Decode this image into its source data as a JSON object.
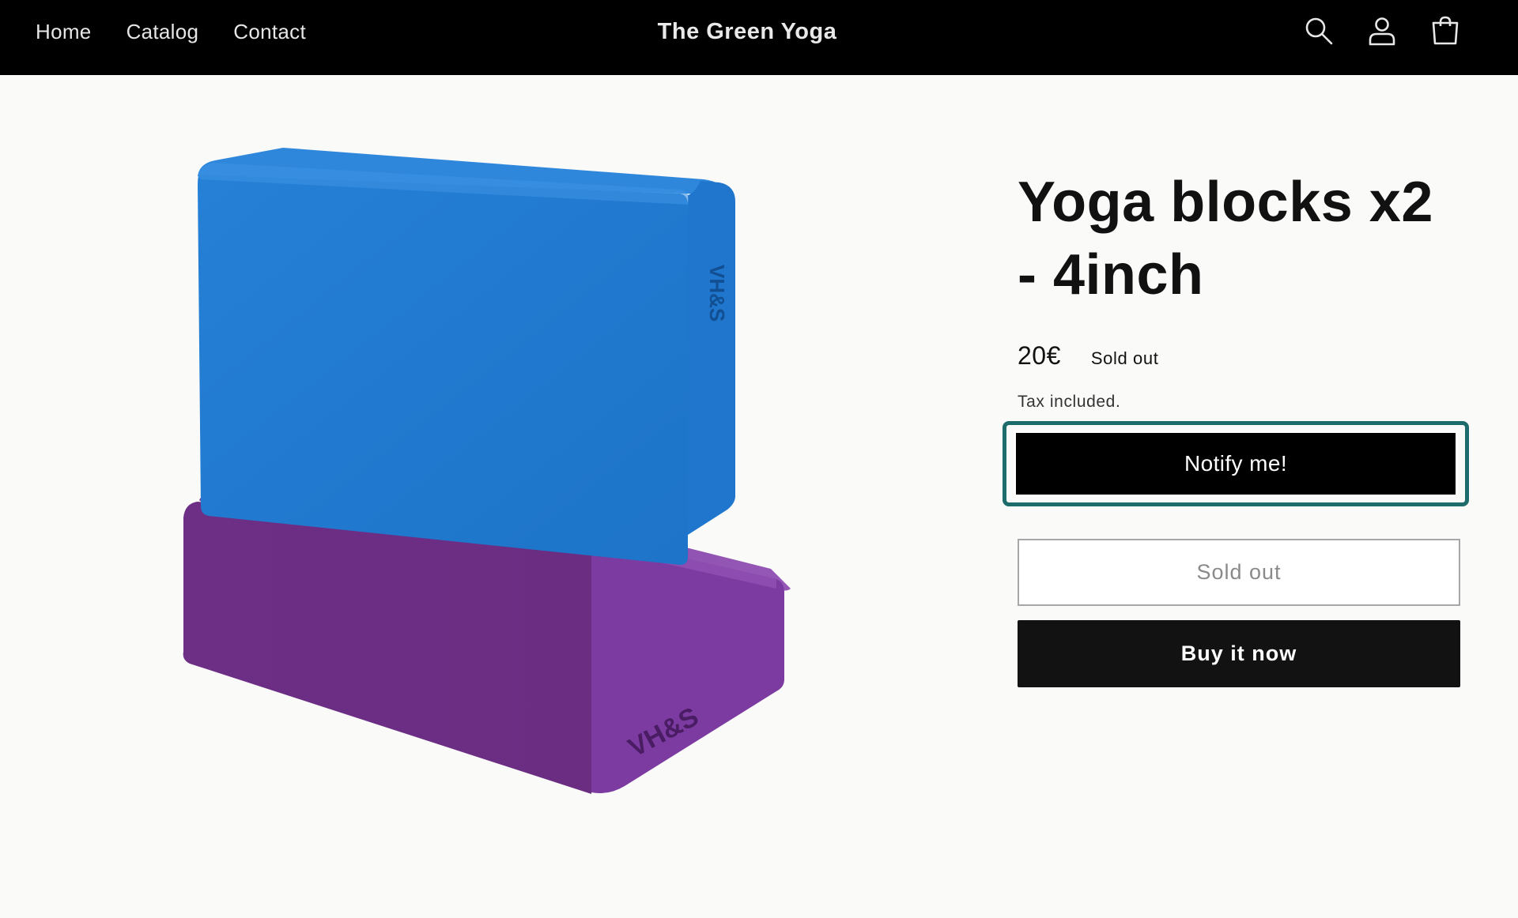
{
  "header": {
    "nav": [
      {
        "label": "Home"
      },
      {
        "label": "Catalog"
      },
      {
        "label": "Contact"
      }
    ],
    "brand": "The Green Yoga",
    "icons": [
      "search-icon",
      "account-icon",
      "cart-icon"
    ]
  },
  "product": {
    "title_line1": "Yoga blocks x2",
    "title_line2": "- 4inch",
    "price": "20€",
    "badge": "Sold out",
    "tax_note": "Tax included.",
    "notify_label": "Notify me!",
    "soldout_label": "Sold out",
    "buy_label": "Buy it now",
    "image": {
      "subject": "two foam yoga blocks stacked, blue on top of purple",
      "block_top_color": "#1f7ad0",
      "block_bottom_color": "#7b3a9a",
      "logo_text": "H&S"
    }
  },
  "colors": {
    "header_bg": "#000000",
    "focus_ring": "#1e6b6b",
    "page_bg": "#fafaf9"
  }
}
